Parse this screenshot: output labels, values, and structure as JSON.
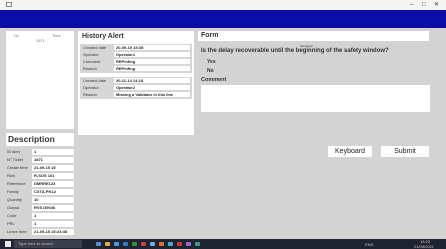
{
  "window": {
    "minimize_glyph": "–",
    "maximize_glyph": "□",
    "close_glyph": "✕"
  },
  "history_alert": {
    "title": "History Alert",
    "rows_a": [
      {
        "label": "Created date",
        "value": "20-09-10 15:35"
      },
      {
        "label": "Operator",
        "value": "Operator1"
      },
      {
        "label": "Comment",
        "value": "REPinfing"
      },
      {
        "label": "Reason",
        "value": "REPinfing"
      }
    ],
    "rows_b": [
      {
        "label": "Created date",
        "value": "20-11-14 14:18"
      },
      {
        "label": "Operator",
        "value": "Operator2"
      },
      {
        "label": "Reason",
        "value": "Missing a Validator in this line"
      }
    ]
  },
  "thumb": {
    "col_a": "No",
    "col_b": "Time",
    "value": "1871"
  },
  "form": {
    "title": "Form",
    "small_heading": "Item/topic",
    "question": "Is the delay recoverable until the beginning of the safety window?",
    "options": [
      "Yes",
      "No"
    ],
    "comment_label": "Comment",
    "comment_value": "",
    "keyboard_label": "Keyboard",
    "submit_label": "Submit"
  },
  "description": {
    "title": "Description",
    "rows": [
      {
        "label": "ID alert",
        "value": "1"
      },
      {
        "label": "N° Ticket",
        "value": "1871"
      },
      {
        "label": "Create time",
        "value": "21-09-15 15"
      },
      {
        "label": "Rich",
        "value": "R-SOS 101"
      },
      {
        "label": "Reference",
        "value": "DMRRE123"
      },
      {
        "label": "Family",
        "value": "CXTA-PK12"
      },
      {
        "label": "Quantity",
        "value": "10"
      },
      {
        "label": "Output",
        "value": "RVS D0046"
      },
      {
        "label": "Code",
        "value": "1"
      },
      {
        "label": "PRL",
        "value": "1"
      },
      {
        "label": "Leave time",
        "value": "21-09-15 15:23:48"
      }
    ]
  },
  "taskbar": {
    "search_placeholder": "Type here to search",
    "tray_text": "ENG",
    "clock_time": "15:23",
    "clock_date": "21/09/2021",
    "icon_colors": [
      "#5a8de0",
      "#e0b040",
      "#3aa0e0",
      "#2e7bd6",
      "#3c8a3c",
      "#d04040",
      "#7aa8e8",
      "#e07030",
      "#4aa8d8",
      "#c03a3a",
      "#9a6ad0",
      "#3a9a8a"
    ]
  },
  "colors": {
    "title_blue": "#0c0ca6",
    "background": "#d3d3d3",
    "taskbar": "#1f2430"
  }
}
